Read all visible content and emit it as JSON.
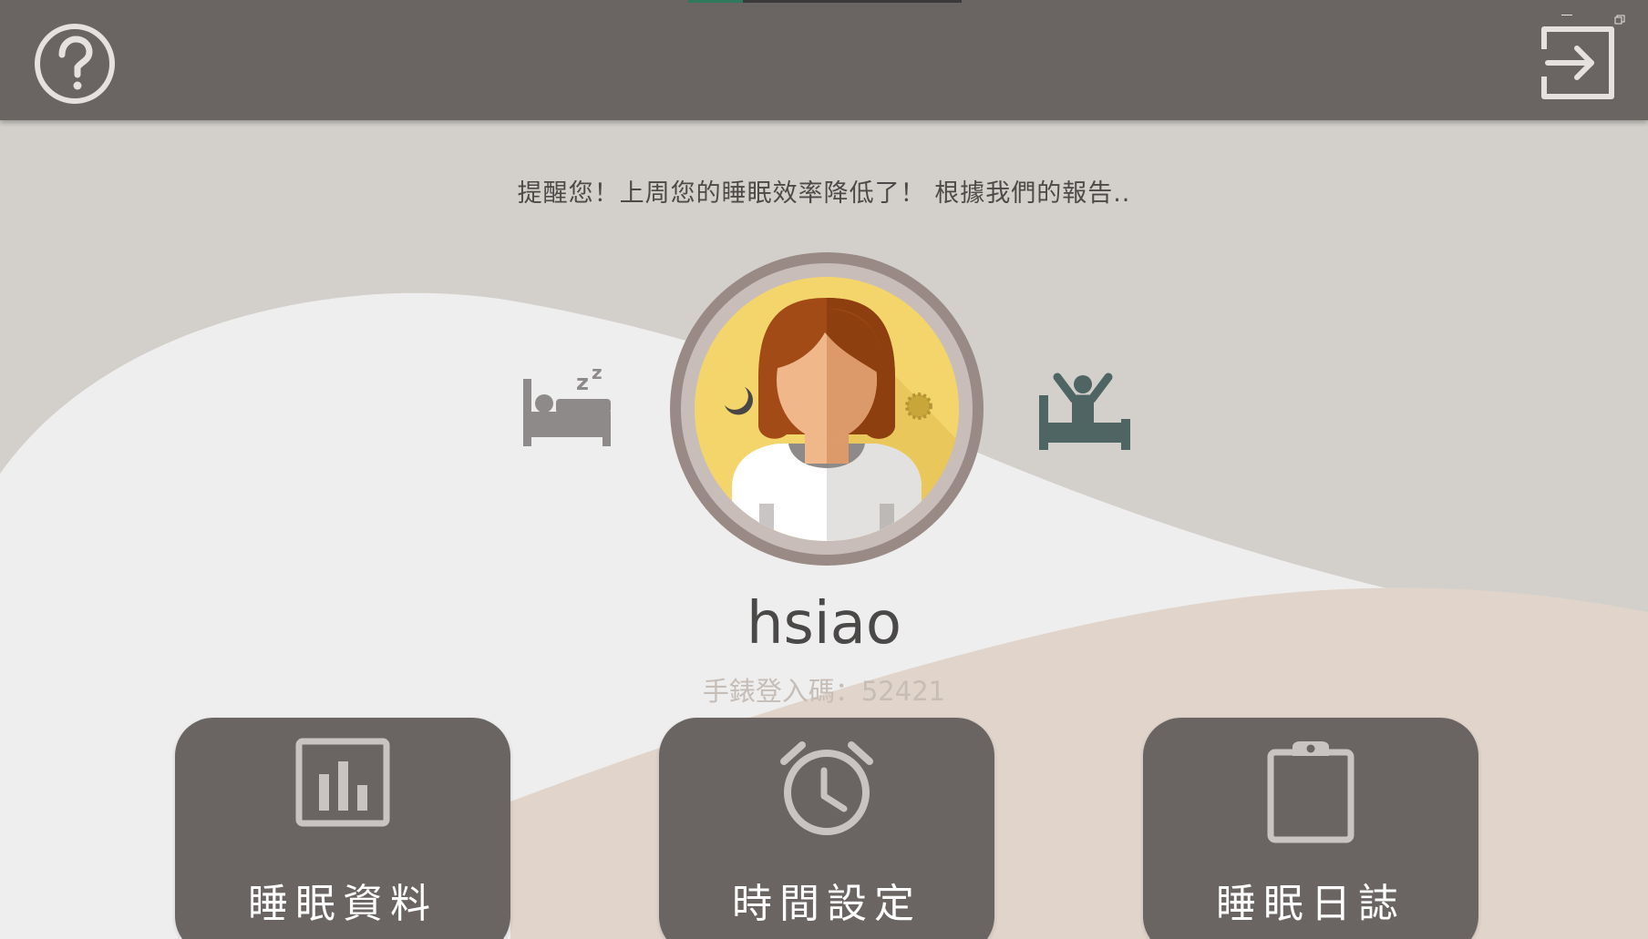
{
  "header": {
    "help_icon": "help-circle-icon",
    "logout_icon": "exit-arrow-icon"
  },
  "reminder": "提醒您！上周您的睡眠效率降低了！ 根據我們的報告..",
  "profile": {
    "username": "hsiao",
    "watch_code": "手錶登入碼：52421",
    "sleep_icon": "bed-sleep-icon",
    "wake_icon": "wake-up-icon",
    "avatar_icon": "avatar-day-night-icon"
  },
  "tiles": [
    {
      "label": "睡眠資料",
      "icon": "bar-chart-icon"
    },
    {
      "label": "時間設定",
      "icon": "alarm-clock-icon"
    },
    {
      "label": "睡眠日誌",
      "icon": "clipboard-icon"
    }
  ],
  "colors": {
    "topbar": "#6a6563",
    "background": "#d3d0cb",
    "wave_white": "#efeeef",
    "wave_beige": "#e1d5cb",
    "tile": "#6a6563",
    "wake_icon": "#4f6564",
    "avatar_ring": "#9a8a86",
    "avatar_face": "#f3d56c"
  }
}
